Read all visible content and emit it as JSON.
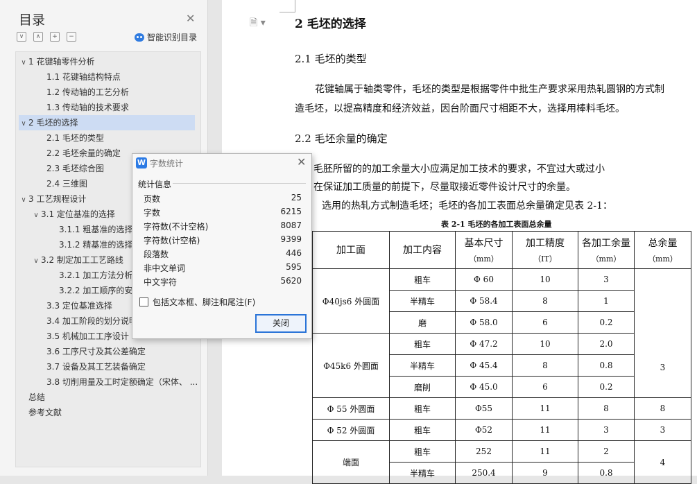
{
  "toc": {
    "title": "目录",
    "smart_toc_label": "智能识别目录",
    "toolbar_icons": [
      "collapse-all-icon",
      "expand-up-icon",
      "add-icon",
      "remove-icon"
    ],
    "items": [
      {
        "text": "1 花键轴零件分析",
        "caret": "∨",
        "level": 0,
        "selected": false
      },
      {
        "text": "1.1 花键轴结构特点",
        "caret": "",
        "level": 1,
        "selected": false
      },
      {
        "text": "1.2 传动轴的工艺分析",
        "caret": "",
        "level": 1,
        "selected": false
      },
      {
        "text": "1.3 传动轴的技术要求",
        "caret": "",
        "level": 1,
        "selected": false
      },
      {
        "text": "2 毛坯的选择",
        "caret": "∨",
        "level": 0,
        "selected": true
      },
      {
        "text": "2.1 毛坯的类型",
        "caret": "",
        "level": 1,
        "selected": false
      },
      {
        "text": "2.2 毛坯余量的确定",
        "caret": "",
        "level": 1,
        "selected": false
      },
      {
        "text": "2.3 毛坯综合图",
        "caret": "",
        "level": 1,
        "selected": false
      },
      {
        "text": "2.4 三维图",
        "caret": "",
        "level": 1,
        "selected": false
      },
      {
        "text": "3 工艺规程设计",
        "caret": "∨",
        "level": 0,
        "selected": false
      },
      {
        "text": "3.1 定位基准的选择",
        "caret": "∨",
        "level": 1,
        "selected": false
      },
      {
        "text": "3.1.1 粗基准的选择",
        "caret": "",
        "level": 2,
        "selected": false
      },
      {
        "text": "3.1.2 精基准的选择",
        "caret": "",
        "level": 2,
        "selected": false
      },
      {
        "text": "3.2 制定加工工艺路线",
        "caret": "∨",
        "level": 1,
        "selected": false
      },
      {
        "text": "3.2.1 加工方法分析确",
        "caret": "",
        "level": 2,
        "selected": false
      },
      {
        "text": "3.2.2 加工顺序的安排",
        "caret": "",
        "level": 2,
        "selected": false
      },
      {
        "text": "3.3 定位基准选择",
        "caret": "",
        "level": 1,
        "selected": false
      },
      {
        "text": "3.4 加工阶段的划分说明",
        "caret": "",
        "level": 1,
        "selected": false
      },
      {
        "text": "3.5 机械加工工序设计",
        "caret": "",
        "level": 1,
        "selected": false
      },
      {
        "text": "3.6 工序尺寸及其公差确定",
        "caret": "",
        "level": 1,
        "selected": false
      },
      {
        "text": "3.7 设备及其工艺装备确定",
        "caret": "",
        "level": 1,
        "selected": false
      },
      {
        "text": "3.8 切削用量及工时定额确定（宋体、 ...",
        "caret": "",
        "level": 1,
        "selected": false
      },
      {
        "text": "总结",
        "caret": "",
        "level": -1,
        "selected": false
      },
      {
        "text": "参考文献",
        "caret": "",
        "level": -1,
        "selected": false
      }
    ]
  },
  "word_count": {
    "title": "字数统计",
    "section_label": "统计信息",
    "stats": [
      {
        "label": "页数",
        "value": "25"
      },
      {
        "label": "字数",
        "value": "6215"
      },
      {
        "label": "字符数(不计空格)",
        "value": "8087"
      },
      {
        "label": "字符数(计空格)",
        "value": "9399"
      },
      {
        "label": "段落数",
        "value": "446"
      },
      {
        "label": "非中文单词",
        "value": "595"
      },
      {
        "label": "中文字符",
        "value": "5620"
      }
    ],
    "checkbox_label": "包括文本框、脚注和尾注(F)",
    "checkbox_checked": false,
    "close_label": "关闭"
  },
  "document": {
    "heading1": "2   毛坯的选择",
    "heading2_1": "2.1   毛坯的类型",
    "para1_line1": "花键轴属于轴类零件，毛坯的类型是根据零件中批生产要求采用热轧圆钢的方式制",
    "para1_line2": "造毛坯，以提高精度和经济效益，因台阶面尺寸相距不大，选择用棒料毛坯。",
    "heading2_2": "2.2   毛坯余量的确定",
    "para2_line1": "毛胚所留的的加工余量大小应满足加工技术的要求，不宜过大或过小",
    "para2_line2": "在保证加工质量的前提下，尽量取接近零件设计尺寸的余量。",
    "para3": "选用的热轧方式制造毛坯；毛坯的各加工表面总余量确定见表 2-1：",
    "table_caption": "表 2-1   毛坯的各加工表面总余量",
    "table": {
      "headers": [
        "加工面",
        "加工内容",
        "基本尺寸",
        "加工精度",
        "各加工余量",
        "总余量"
      ],
      "units": [
        "（mm）",
        "（IT）",
        "（mm）",
        "（mm）"
      ],
      "groups": [
        {
          "surface": "Φ40js6 外圆面",
          "total": "",
          "rows": [
            {
              "content": "粗车",
              "size": "Φ 60",
              "it": "10",
              "allow": "3"
            },
            {
              "content": "半精车",
              "size": "Φ 58.4",
              "it": "8",
              "allow": "1"
            },
            {
              "content": "磨",
              "size": "Φ 58.0",
              "it": "6",
              "allow": "0.2"
            }
          ]
        },
        {
          "surface": "Φ45k6 外圆面",
          "total": "3",
          "rows": [
            {
              "content": "粗车",
              "size": "Φ 47.2",
              "it": "10",
              "allow": "2.0"
            },
            {
              "content": "半精车",
              "size": "Φ 45.4",
              "it": "8",
              "allow": "0.8"
            },
            {
              "content": "磨削",
              "size": "Φ 45.0",
              "it": "6",
              "allow": "0.2"
            }
          ]
        },
        {
          "surface": "Φ 55 外圆面",
          "total": "8",
          "rows": [
            {
              "content": "粗车",
              "size": "Φ55",
              "it": "11",
              "allow": "8"
            }
          ]
        },
        {
          "surface": "Φ 52 外圆面",
          "total": "3",
          "rows": [
            {
              "content": "粗车",
              "size": "Φ52",
              "it": "11",
              "allow": "3"
            }
          ]
        },
        {
          "surface": "端面",
          "total": "4",
          "rows": [
            {
              "content": "粗车",
              "size": "252",
              "it": "11",
              "allow": "2"
            },
            {
              "content": "半精车",
              "size": "250.4",
              "it": "9",
              "allow": "0.8"
            }
          ]
        }
      ]
    }
  }
}
